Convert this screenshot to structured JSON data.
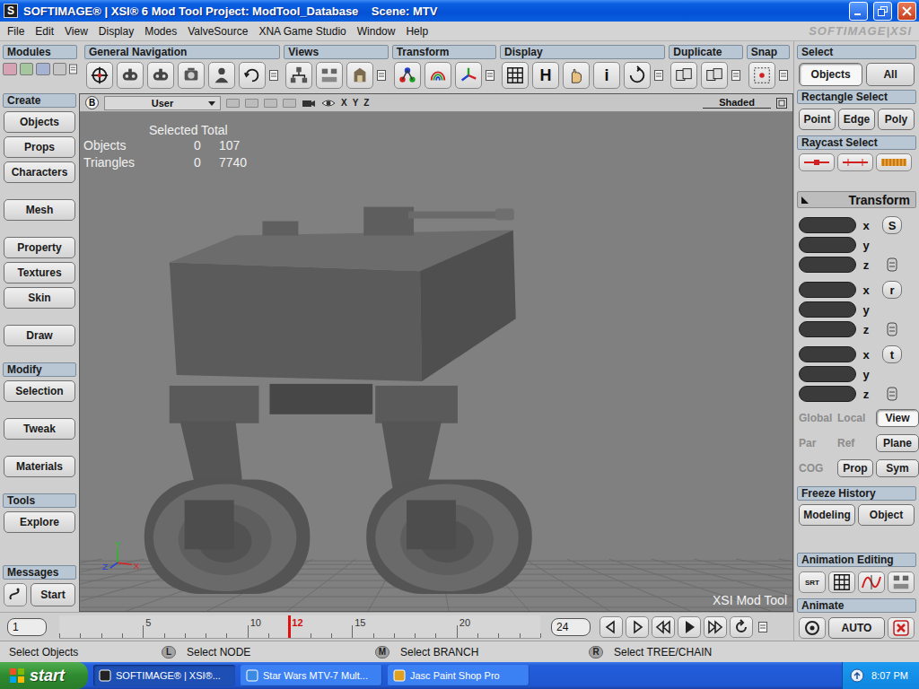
{
  "window": {
    "app_icon": "S",
    "title": "SOFTIMAGE® | XSI® 6 Mod Tool Project: ModTool_Database    Scene: MTV"
  },
  "menu": {
    "items": [
      "File",
      "Edit",
      "View",
      "Display",
      "Modes",
      "ValveSource",
      "XNA Game Studio",
      "Window",
      "Help"
    ],
    "brand": "SOFTIMAGE|XSI"
  },
  "modules": {
    "label": "Modules",
    "buttons": [
      {
        "color": "#d6a3b4"
      },
      {
        "color": "#a6c6a0"
      },
      {
        "color": "#a7b3d3"
      },
      {
        "color": "#c6c6c6"
      }
    ]
  },
  "toolbar": [
    {
      "label": "General Navigation",
      "buttons": [
        {
          "kind": "icon"
        },
        {
          "kind": "icon"
        },
        {
          "kind": "icon"
        },
        {
          "kind": "icon"
        },
        {
          "kind": "icon"
        },
        {
          "kind": "icon"
        }
      ]
    },
    {
      "label": "Views",
      "buttons": [
        {
          "kind": "icon"
        },
        {
          "kind": "icon"
        },
        {
          "kind": "icon"
        }
      ]
    },
    {
      "label": "Transform",
      "buttons": [
        {
          "kind": "icon"
        },
        {
          "kind": "icon"
        },
        {
          "kind": "icon"
        }
      ]
    },
    {
      "label": "Display",
      "buttons": [
        {
          "kind": "icon"
        },
        {
          "kind": "letter",
          "label": "H"
        },
        {
          "kind": "icon"
        },
        {
          "kind": "letter",
          "label": "i"
        },
        {
          "kind": "icon"
        }
      ]
    },
    {
      "label": "Duplicate",
      "buttons": [
        {
          "kind": "icon"
        },
        {
          "kind": "icon"
        }
      ]
    },
    {
      "label": "Snap",
      "buttons": [
        {
          "kind": "icon"
        }
      ]
    }
  ],
  "left_panel": {
    "sections": [
      {
        "label": "Create",
        "groups": [
          [
            "Objects",
            "Props",
            "Characters"
          ],
          [
            "Mesh"
          ],
          [
            "Property",
            "Textures",
            "Skin"
          ],
          [
            "Draw"
          ]
        ]
      },
      {
        "label": "Modify",
        "groups": [
          [
            "Selection"
          ],
          [
            "Tweak"
          ],
          [
            "Materials"
          ]
        ]
      },
      {
        "label": "Tools",
        "groups": [
          [
            "Explore"
          ]
        ]
      }
    ],
    "messages": {
      "label": "Messages",
      "button": "Start"
    }
  },
  "viewport": {
    "badge": "B",
    "camera": "User",
    "axis_toggles": [
      "X",
      "Y",
      "Z"
    ],
    "mode": "Shaded",
    "hud": {
      "header": "Selected Total",
      "rows": [
        {
          "label": "Objects",
          "selected": "0",
          "total": "107"
        },
        {
          "label": "Triangles",
          "selected": "0",
          "total": "7740"
        }
      ]
    },
    "gizmo": {
      "x": "X",
      "y": "Y",
      "z": "Z"
    },
    "watermark": "XSI Mod Tool"
  },
  "select": {
    "label": "Select",
    "buttons": [
      {
        "label": "Objects",
        "selected": true
      },
      {
        "label": "All",
        "selected": false
      }
    ]
  },
  "rectangle_select": {
    "label": "Rectangle Select",
    "buttons": [
      "Point",
      "Edge",
      "Poly"
    ]
  },
  "raycast_select": {
    "label": "Raycast Select"
  },
  "transform": {
    "label": "Transform",
    "groups": [
      {
        "key": "S",
        "axes": [
          "x",
          "y",
          "z"
        ]
      },
      {
        "key": "r",
        "axes": [
          "x",
          "y",
          "z"
        ]
      },
      {
        "key": "t",
        "axes": [
          "x",
          "y",
          "z"
        ]
      }
    ],
    "reference": [
      [
        {
          "label": "Global",
          "disabled": true,
          "selected": false
        },
        {
          "label": "Local",
          "disabled": true,
          "selected": false
        },
        {
          "label": "View",
          "disabled": false,
          "selected": true
        }
      ],
      [
        {
          "label": "Par",
          "disabled": true,
          "selected": false
        },
        {
          "label": "Ref",
          "disabled": true,
          "selected": false
        },
        {
          "label": "Plane",
          "disabled": false,
          "selected": false
        }
      ],
      [
        {
          "label": "COG",
          "disabled": true,
          "selected": false
        },
        {
          "label": "Prop",
          "disabled": false,
          "selected": false
        },
        {
          "label": "Sym",
          "disabled": false,
          "selected": false
        }
      ]
    ]
  },
  "freeze_history": {
    "label": "Freeze History",
    "buttons": [
      "Modeling",
      "Object"
    ]
  },
  "animation_editing": {
    "label": "Animation Editing",
    "srt": "SRT"
  },
  "animate": {
    "label": "Animate",
    "auto": "AUTO"
  },
  "timeline": {
    "start": "1",
    "end": "24",
    "current": "12",
    "ticks": [
      "5",
      "10",
      "15",
      "20"
    ]
  },
  "status_bar": {
    "hint": "Select Objects",
    "mouse": [
      {
        "key": "L",
        "action": "Select NODE"
      },
      {
        "key": "M",
        "action": "Select BRANCH"
      },
      {
        "key": "R",
        "action": "Select TREE/CHAIN"
      }
    ]
  },
  "taskbar": {
    "start": "start",
    "tasks": [
      {
        "label": "SOFTIMAGE® | XSI®...",
        "selected": true
      },
      {
        "label": "Star Wars MTV-7 Mult...",
        "selected": false
      },
      {
        "label": "Jasc Paint Shop Pro",
        "selected": false
      }
    ],
    "clock": "8:07 PM"
  }
}
